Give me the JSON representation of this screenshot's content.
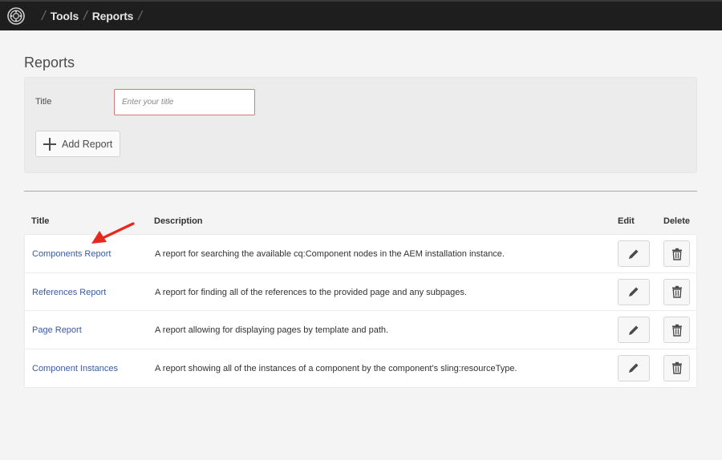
{
  "topbar": {
    "logo_icon": "aem-logo-icon",
    "breadcrumbs": [
      {
        "label": "Tools"
      },
      {
        "label": "Reports"
      }
    ]
  },
  "page": {
    "title": "Reports"
  },
  "form": {
    "title_label": "Title",
    "title_input_value": "",
    "title_input_placeholder": "Enter your title",
    "add_button_label": "Add Report",
    "add_button_icon": "plus-icon"
  },
  "table": {
    "columns": {
      "title": "Title",
      "description": "Description",
      "edit": "Edit",
      "delete": "Delete"
    },
    "rows": [
      {
        "title": "Components Report",
        "description": "A report for searching the available cq:Component nodes in the AEM installation instance."
      },
      {
        "title": "References Report",
        "description": "A report for finding all of the references to the provided page and any subpages."
      },
      {
        "title": "Page Report",
        "description": "A report allowing for displaying pages by template and path."
      },
      {
        "title": "Component Instances",
        "description": "A report showing all of the instances of a component by the component's sling:resourceType."
      }
    ]
  },
  "annotation": {
    "arrow_color": "#e8271d",
    "points_to": "Components Report"
  },
  "colors": {
    "topbar_bg": "#1e1e1e",
    "link": "#3c5a9e",
    "input_error_border": "#d7797a"
  }
}
